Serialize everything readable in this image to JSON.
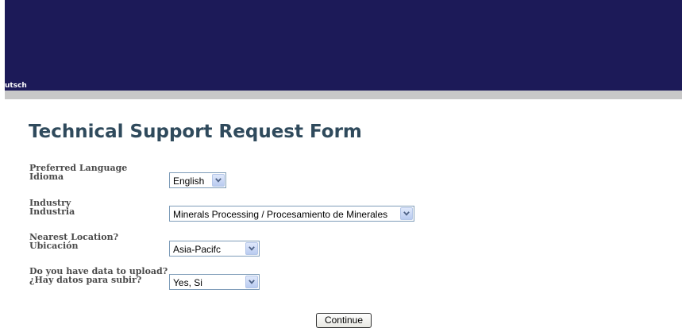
{
  "header": {
    "language_link": "utsch"
  },
  "page": {
    "title": "Technical Support Request Form"
  },
  "form": {
    "language": {
      "label_en": "Preferred Language",
      "label_es": "Idioma",
      "selected": "English"
    },
    "industry": {
      "label_en": "Industry",
      "label_es": "Industria",
      "selected": "Minerals Processing / Procesamiento de Minerales"
    },
    "location": {
      "label_en": "Nearest Location?",
      "label_es": "Ubicación",
      "selected": "Asia-Pacifc"
    },
    "data_upload": {
      "label_en": "Do you have data to upload?",
      "label_es": "¿Hay datos para subir?",
      "selected": "Yes, Si"
    },
    "continue_label": "Continue"
  },
  "icons": {
    "dropdown": "chevron-down-icon"
  },
  "colors": {
    "banner": "#1c1a58",
    "grey_bar": "#c8c8c8",
    "title": "#2f4a5c",
    "label": "#4a4a4a",
    "select_border": "#7f9db9",
    "dropdown_arrow": "#4d6185"
  }
}
